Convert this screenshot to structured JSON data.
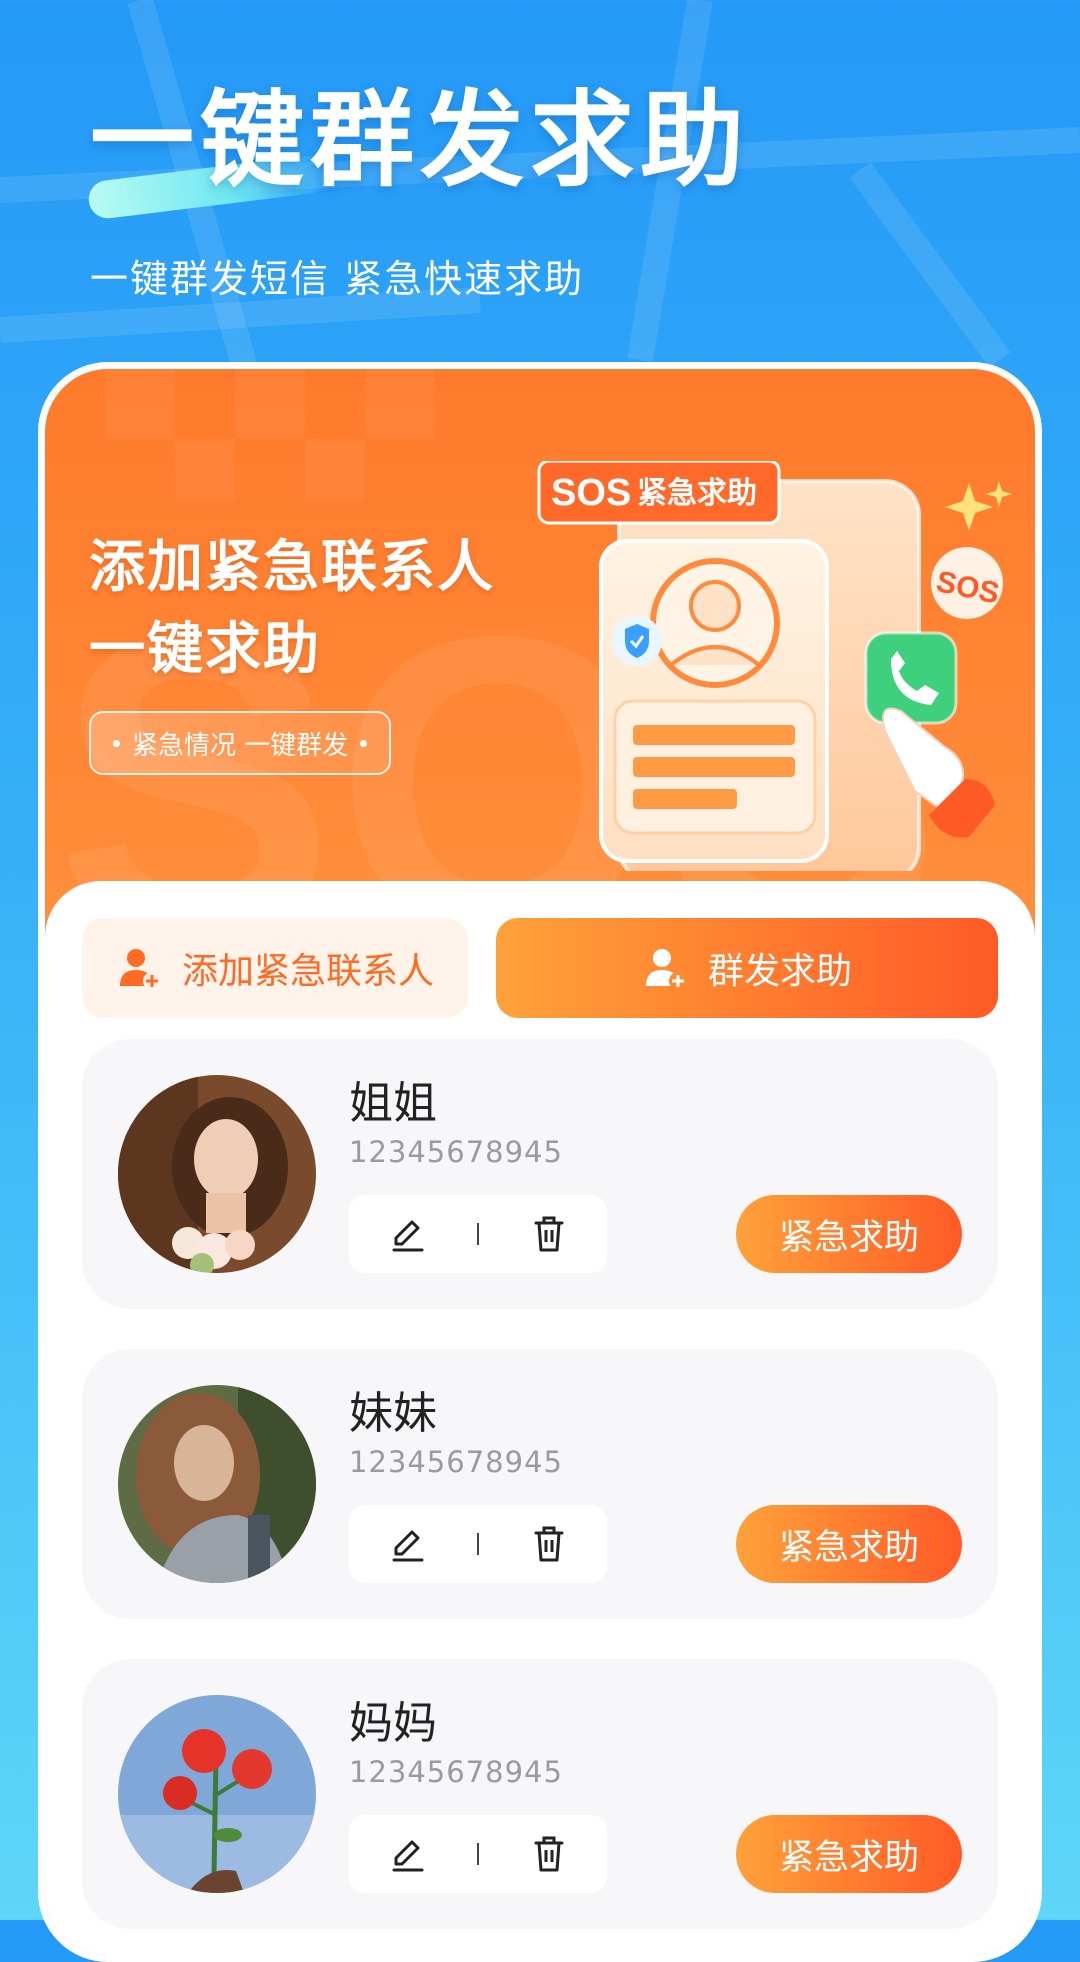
{
  "header": {
    "title": "一键群发求助",
    "subtitle": "一键群发短信  紧急快速求助"
  },
  "banner": {
    "title_line1": "添加紧急联系人",
    "title_line2": "一键求助",
    "pill_text": "紧急情况  一键群发",
    "badge_sos": "SOS",
    "badge_text": "紧急求助",
    "bubble_text": "SOS"
  },
  "actions": {
    "add_contact_label": "添加紧急联系人",
    "group_help_label": "群发求助"
  },
  "contacts": [
    {
      "name": "姐姐",
      "phone": "12345678945",
      "sos_label": "紧急求助"
    },
    {
      "name": "妹妹",
      "phone": "12345678945",
      "sos_label": "紧急求助"
    },
    {
      "name": "妈妈",
      "phone": "12345678945",
      "sos_label": "紧急求助"
    }
  ],
  "colors": {
    "sky_blue": "#2499f7",
    "accent_orange": "#ff5a26",
    "accent_light": "#ffa23a"
  }
}
